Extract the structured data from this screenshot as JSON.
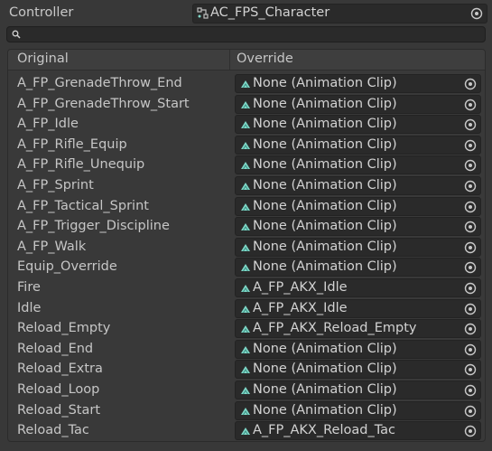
{
  "controller": {
    "label": "Controller",
    "value": "AC_FPS_Character",
    "icon": "animator-controller-icon"
  },
  "search": {
    "placeholder": ""
  },
  "table": {
    "columns": [
      "Original",
      "Override"
    ],
    "rows": [
      {
        "original": "A_FP_GrenadeThrow_End",
        "override": "None (Animation Clip)"
      },
      {
        "original": "A_FP_GrenadeThrow_Start",
        "override": "None (Animation Clip)"
      },
      {
        "original": "A_FP_Idle",
        "override": "None (Animation Clip)"
      },
      {
        "original": "A_FP_Rifle_Equip",
        "override": "None (Animation Clip)"
      },
      {
        "original": "A_FP_Rifle_Unequip",
        "override": "None (Animation Clip)"
      },
      {
        "original": "A_FP_Sprint",
        "override": "None (Animation Clip)"
      },
      {
        "original": "A_FP_Tactical_Sprint",
        "override": "None (Animation Clip)"
      },
      {
        "original": "A_FP_Trigger_Discipline",
        "override": "None (Animation Clip)"
      },
      {
        "original": "A_FP_Walk",
        "override": "None (Animation Clip)"
      },
      {
        "original": "Equip_Override",
        "override": "None (Animation Clip)"
      },
      {
        "original": "Fire",
        "override": "A_FP_AKX_Idle"
      },
      {
        "original": "Idle",
        "override": "A_FP_AKX_Idle"
      },
      {
        "original": "Reload_Empty",
        "override": "A_FP_AKX_Reload_Empty"
      },
      {
        "original": "Reload_End",
        "override": "None (Animation Clip)"
      },
      {
        "original": "Reload_Extra",
        "override": "None (Animation Clip)"
      },
      {
        "original": "Reload_Loop",
        "override": "None (Animation Clip)"
      },
      {
        "original": "Reload_Start",
        "override": "None (Animation Clip)"
      },
      {
        "original": "Reload_Tac",
        "override": "A_FP_AKX_Reload_Tac"
      }
    ]
  },
  "colors": {
    "background": "#383838",
    "field": "#2a2a2a",
    "clip_icon": "#7fd8c8",
    "text": "#c6c6c6"
  }
}
